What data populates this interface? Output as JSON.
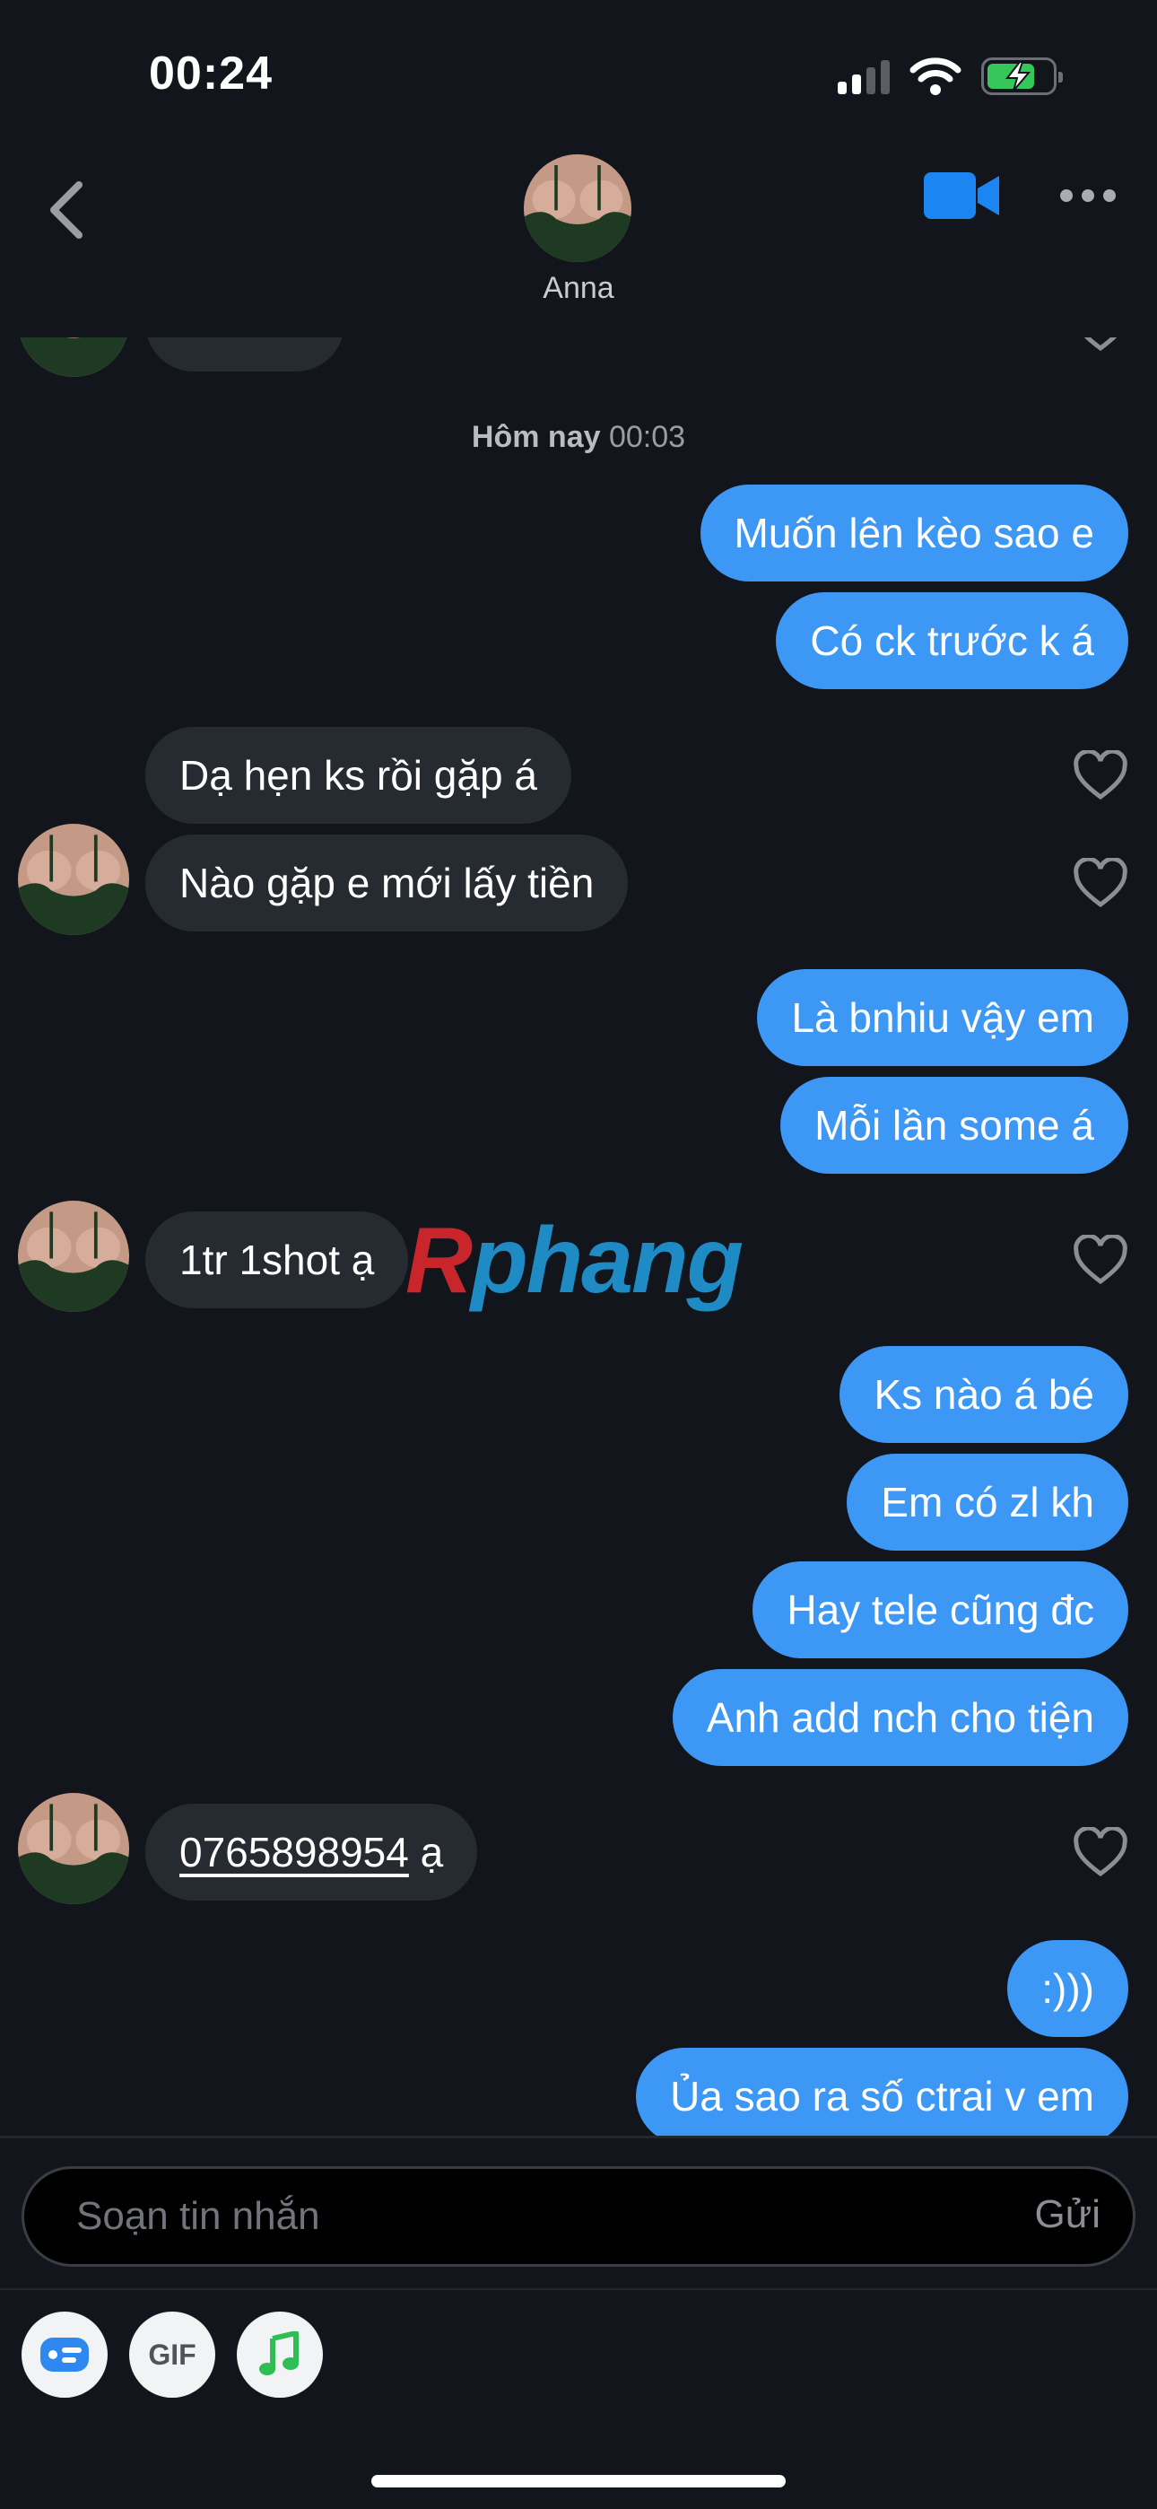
{
  "status_bar": {
    "time": "00:24",
    "icons": [
      "cellular-signal-icon",
      "wifi-icon",
      "battery-charging-icon"
    ]
  },
  "header": {
    "contact_name": "Anna",
    "icons": [
      "back-chevron-icon",
      "video-call-icon",
      "more-options-icon"
    ]
  },
  "colors": {
    "background": "#12151c",
    "outgoing_bubble": "#3d97f4",
    "incoming_bubble": "#262a31"
  },
  "chat": {
    "date_separator": {
      "day": "Hôm nay",
      "time": "00:03"
    },
    "messages": [
      {
        "from": "me",
        "text": "Muốn lên kèo sao e"
      },
      {
        "from": "me",
        "text": "Có ck trước k á"
      },
      {
        "from": "anna",
        "text": "Dạ hẹn ks rồi gặp á"
      },
      {
        "from": "anna",
        "text": "Nào gặp e mới lấy tiền"
      },
      {
        "from": "me",
        "text": "Là bnhiu vậy em"
      },
      {
        "from": "me",
        "text": "Mỗi lần some á"
      },
      {
        "from": "anna",
        "text": "1tr 1shot ạ"
      },
      {
        "from": "me",
        "text": "Ks nào á bé"
      },
      {
        "from": "me",
        "text": "Em có zl kh"
      },
      {
        "from": "me",
        "text": "Hay tele cũng đc"
      },
      {
        "from": "me",
        "text": "Anh add nch cho tiện"
      },
      {
        "from": "anna",
        "text": "ạ",
        "link": "0765898954"
      },
      {
        "from": "me",
        "text": ":)))"
      },
      {
        "from": "me",
        "text": "Ủa sao ra số ctrai v em"
      }
    ]
  },
  "watermark": {
    "first_letter": "R",
    "rest": "phang"
  },
  "composer": {
    "placeholder": "Soạn tin nhắn",
    "send_label": "Gửi",
    "tools": [
      {
        "icon": "sticker-icon"
      },
      {
        "icon": "gif-icon",
        "label": "GIF"
      },
      {
        "icon": "music-icon"
      }
    ]
  }
}
